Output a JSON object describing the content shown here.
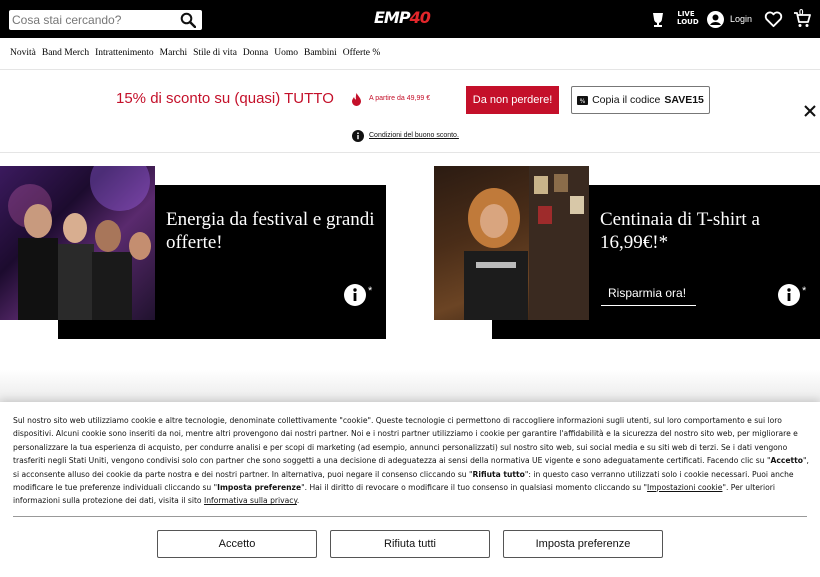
{
  "header": {
    "search_placeholder": "Cosa stai cercando?",
    "logo_main": "EMP",
    "logo_num": "40",
    "live_label_1": "LIVE",
    "live_label_2": "LOUD",
    "login_label": "Login",
    "cart_count": "0"
  },
  "nav": {
    "items": [
      "Novità",
      "Band Merch",
      "Intrattenimento",
      "Marchi",
      "Stile di vita",
      "Donna",
      "Uomo",
      "Bambini",
      "Offerte %"
    ]
  },
  "promo": {
    "title": "15% di sconto su (quasi) TUTTO",
    "subtitle": "A partire da 49,99 €",
    "cta_label": "Da non perdere!",
    "copy_label": "Copia il codice",
    "code": "SAVE15",
    "conditions_link": "Condizioni del buono sconto."
  },
  "banners": [
    {
      "title": "Energia da festival e grandi offerte!",
      "asterisk": "*"
    },
    {
      "title": "Centinaia di T-shirt a 16,99€!*",
      "cta": "Risparmia ora!",
      "asterisk": "*"
    }
  ],
  "cookie": {
    "p1": "Sul nostro sito web utilizziamo cookie e altre tecnologie, denominate collettivamente \"cookie\". Queste tecnologie ci permettono di raccogliere informazioni sugli utenti, sul loro comportamento e sui loro dispositivi. Alcuni cookie sono inseriti da noi, mentre altri provengono dai nostri partner. Noi e i nostri partner utilizziamo i cookie per garantire l'affidabilità e la sicurezza del nostro sito web, per migliorare e personalizzare la tua esperienza di acquisto, per condurre analisi e per scopi di marketing (ad esempio, annunci personalizzati) sul nostro sito web, sui social media e su siti web di terzi. Se i dati vengono trasferiti negli Stati Uniti, vengono condivisi solo con partner che sono soggetti a una decisione di adeguatezza ai sensi della normativa UE vigente e sono adeguatamente certificati. Facendo clic su \"",
    "accept_word": "Accetto",
    "p2": "\", si acconsente alluso dei cookie da parte nostra e dei nostri partner. In alternativa, puoi negare il consenso cliccando su \"",
    "reject_word": "Rifiuta tutto",
    "p3": "\": in questo caso verranno utilizzati solo i cookie necessari. Puoi anche modificare le tue preferenze individuali cliccando su \"",
    "prefs_word": "Imposta preferenze",
    "p4": "\". Hai il diritto di revocare o modificare il tuo consenso in qualsiasi momento cliccando su \"",
    "settings_link": "Impostazioni cookie",
    "p5": "\". Per ulteriori informazioni sulla protezione dei dati, visita il sito ",
    "privacy_link": "Informativa sulla privacy",
    "p6": ".",
    "btn_accept": "Accetto",
    "btn_reject": "Rifiuta tutti",
    "btn_prefs": "Imposta preferenze"
  },
  "colors": {
    "brand_red": "#c4102a",
    "header_bg": "#000000"
  }
}
